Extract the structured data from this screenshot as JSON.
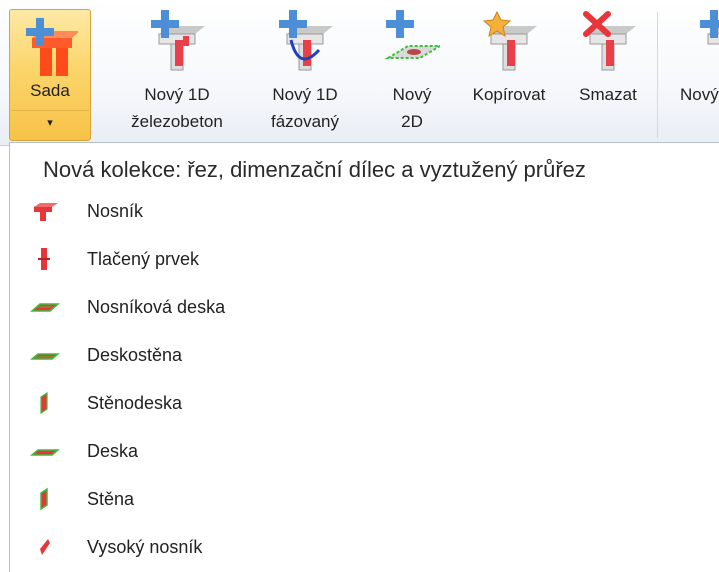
{
  "ribbon": {
    "buttons": [
      {
        "label_line1": "Sada",
        "arrow": "▾",
        "icon": "set-icon"
      },
      {
        "label_line1": "Nový 1D",
        "label_line2": "železobeton",
        "icon": "new-1d-rc-icon"
      },
      {
        "label_line1": "Nový 1D",
        "label_line2": "fázovaný",
        "icon": "new-1d-phased-icon"
      },
      {
        "label_line1": "Nový",
        "label_line2": "2D",
        "icon": "new-2d-icon"
      },
      {
        "label_line1": "Kopírovat",
        "icon": "copy-icon"
      },
      {
        "label_line1": "Smazat",
        "icon": "delete-icon"
      },
      {
        "label_line1": "Nový",
        "icon": "new-icon"
      }
    ]
  },
  "dropdown": {
    "title": "Nová kolekce: řez, dimenzační dílec a vyztužený průřez",
    "items": [
      {
        "label": "Nosník",
        "icon": "beam-icon"
      },
      {
        "label": "Tlačený prvek",
        "icon": "compression-member-icon"
      },
      {
        "label": "Nosníková deska",
        "icon": "beam-slab-icon"
      },
      {
        "label": "Deskostěna",
        "icon": "slab-wall-icon"
      },
      {
        "label": "Stěnodeska",
        "icon": "wall-slab-icon"
      },
      {
        "label": "Deska",
        "icon": "slab-icon"
      },
      {
        "label": "Stěna",
        "icon": "wall-icon"
      },
      {
        "label": "Vysoký nosník",
        "icon": "deep-beam-icon"
      }
    ]
  },
  "colors": {
    "accent": "#fbd56b",
    "red": "#e8353a",
    "green": "#3cbf3c",
    "blue": "#3d85c6"
  }
}
